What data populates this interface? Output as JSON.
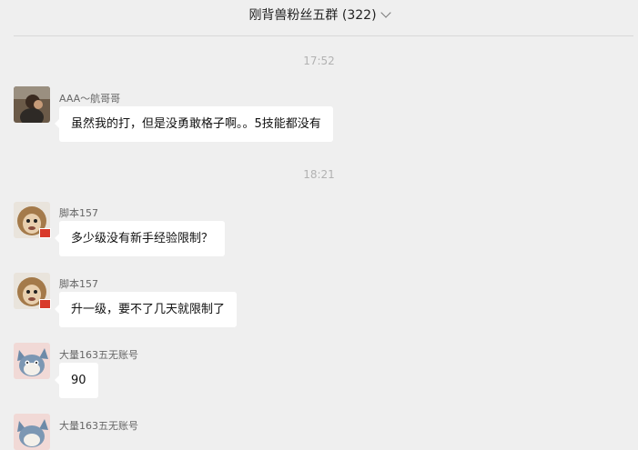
{
  "header": {
    "title": "刚背兽粉丝五群 (322)"
  },
  "timestamps": [
    "17:52",
    "18:21"
  ],
  "messages": [
    {
      "nickname": "AAA～航哥哥",
      "text": "虽然我的打，但是没勇敢格子啊。。5技能都没有",
      "avatar": "photo-avatar"
    },
    {
      "nickname": "脚本157",
      "text": "多少级没有新手经验限制？",
      "avatar": "monkey-avatar"
    },
    {
      "nickname": "脚本157",
      "text": "升一级，要不了几天就限制了",
      "avatar": "monkey-avatar"
    },
    {
      "nickname": "大量163五无账号",
      "text": "90",
      "avatar": "cat-avatar"
    },
    {
      "nickname": "大量163五无账号",
      "text": "",
      "avatar": "cat-avatar"
    }
  ]
}
